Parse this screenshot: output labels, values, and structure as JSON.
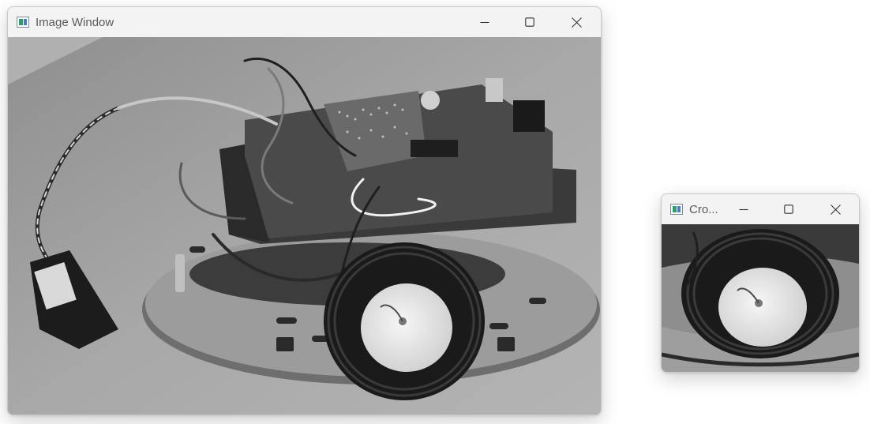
{
  "main_window": {
    "title": "Image Window",
    "minimize_icon": "minimize-icon",
    "maximize_icon": "maximize-icon",
    "close_icon": "close-icon",
    "image_content": "grayscale-robot-photo"
  },
  "crop_window": {
    "title": "Cro...",
    "minimize_icon": "minimize-icon",
    "maximize_icon": "maximize-icon",
    "close_icon": "close-icon",
    "image_content": "grayscale-wheel-crop"
  },
  "colors": {
    "titlebar": "#f3f3f3",
    "title_text": "#5a5a5a",
    "control_glyph": "#333333"
  }
}
